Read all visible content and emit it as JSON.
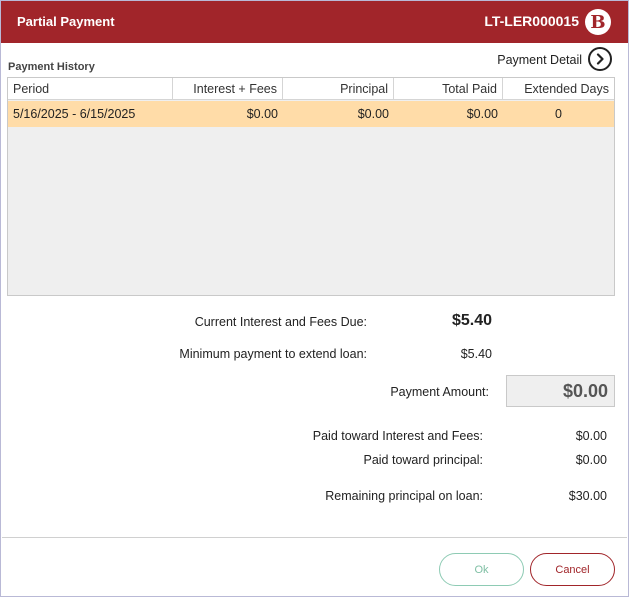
{
  "dialog": {
    "title": "Partial Payment",
    "loan_id": "LT-LER000015",
    "logo_letter": "B"
  },
  "history": {
    "label": "Payment History",
    "detail_link": "Payment Detail",
    "columns": [
      "Period",
      "Interest + Fees",
      "Principal",
      "Total Paid",
      "Extended Days"
    ],
    "rows": [
      {
        "period": "5/16/2025 - 6/15/2025",
        "interest_fees": "$0.00",
        "principal": "$0.00",
        "total_paid": "$0.00",
        "extended_days": "0"
      }
    ]
  },
  "summary": {
    "current_due_label": "Current Interest and Fees Due:",
    "current_due_value": "$5.40",
    "min_payment_label": "Minimum payment to extend loan:",
    "min_payment_value": "$5.40",
    "payment_amount_label": "Payment Amount:",
    "payment_amount_value": "$0.00",
    "paid_interest_label": "Paid toward Interest and Fees:",
    "paid_interest_value": "$0.00",
    "paid_principal_label": "Paid toward principal:",
    "paid_principal_value": "$0.00",
    "remaining_label": "Remaining principal on loan:",
    "remaining_value": "$30.00"
  },
  "buttons": {
    "ok": "Ok",
    "cancel": "Cancel"
  },
  "colors": {
    "brand": "#a1252a",
    "selected_row": "#ffdca8",
    "ok_border": "#8ecbb4"
  }
}
